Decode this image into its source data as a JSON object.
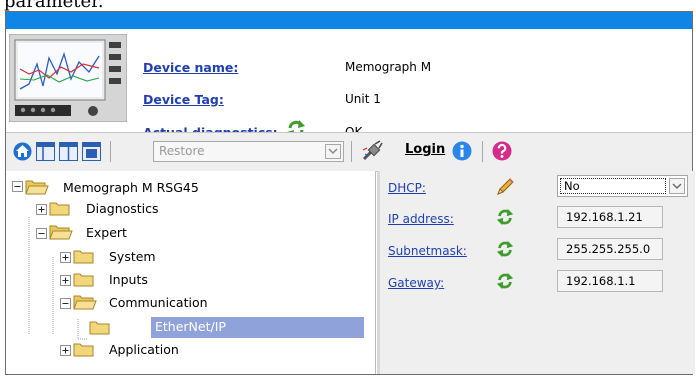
{
  "caption": "parameter.",
  "header": {
    "device_name_label": "Device name:",
    "device_name_value": "Memograph M",
    "device_tag_label": "Device Tag:",
    "device_tag_value": "Unit 1",
    "diagnostics_label": "Actual diagnostics:",
    "diagnostics_value": "OK"
  },
  "toolbar": {
    "restore_label": "Restore",
    "login_label": "Login"
  },
  "tree": [
    {
      "label": "Memograph M RSG45",
      "state": "expanded"
    },
    {
      "label": "Diagnostics",
      "state": "collapsed"
    },
    {
      "label": "Expert",
      "state": "expanded"
    },
    {
      "label": "System",
      "state": "collapsed"
    },
    {
      "label": "Inputs",
      "state": "collapsed"
    },
    {
      "label": "Communication",
      "state": "expanded"
    },
    {
      "label": "EtherNet/IP",
      "state": "selected"
    },
    {
      "label": "Application",
      "state": "collapsed"
    }
  ],
  "params": {
    "dhcp_label": "DHCP:",
    "dhcp_value": "No",
    "ip_label": "IP address:",
    "ip_value": "192.168.1.21",
    "subnet_label": "Subnetmask:",
    "subnet_value": "255.255.255.0",
    "gateway_label": "Gateway:",
    "gateway_value": "192.168.1.1"
  },
  "colors": {
    "titlebar": "#0f86e6",
    "link": "#1f3fb0",
    "selection": "#8fa3da",
    "refresh_green": "#3f9b2a",
    "help_magenta": "#d42c8a"
  }
}
